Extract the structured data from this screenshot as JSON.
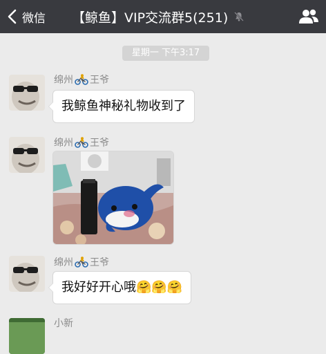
{
  "header": {
    "back_label": "微信",
    "title": "【鲸鱼】VIP交流群5(251)",
    "icons": [
      "chevron-left-icon",
      "mute-bell-icon",
      "group-members-icon"
    ]
  },
  "timestamp": "星期一 下午3:17",
  "messages": [
    {
      "sender_prefix": "绵州",
      "sender_suffix": "王爷",
      "type": "text",
      "text": "我鲸鱼神秘礼物收到了"
    },
    {
      "sender_prefix": "绵州",
      "sender_suffix": "王爷",
      "type": "image",
      "image_subject": "blue-whale-plush-and-bottle"
    },
    {
      "sender_prefix": "绵州",
      "sender_suffix": "王爷",
      "type": "text",
      "text": "我好好开心哦",
      "emoji": "🤗🤗🤗"
    },
    {
      "sender_prefix": "小新",
      "type": "partial"
    }
  ]
}
